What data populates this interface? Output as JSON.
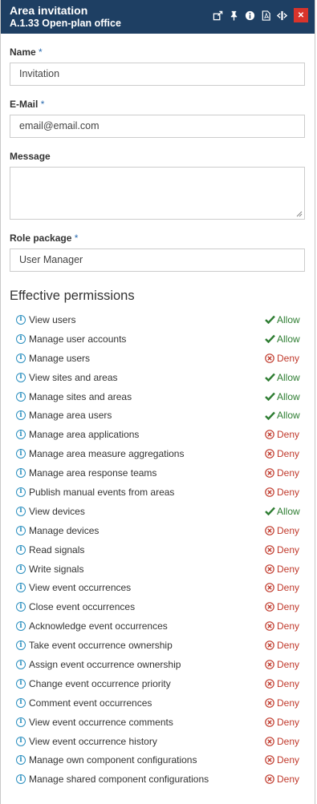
{
  "header": {
    "title": "Area invitation",
    "subtitle": "A.1.33 Open-plan office",
    "close_label": "✕"
  },
  "form": {
    "name_label": "Name",
    "name_required": "*",
    "name_value": "Invitation",
    "email_label": "E-Mail",
    "email_required": "*",
    "email_value": "email@email.com",
    "message_label": "Message",
    "message_value": "",
    "role_label": "Role package",
    "role_required": "*",
    "role_value": "User Manager"
  },
  "permissions": {
    "title": "Effective permissions",
    "items": [
      {
        "label": "View users",
        "status": "Allow"
      },
      {
        "label": "Manage user accounts",
        "status": "Allow"
      },
      {
        "label": "Manage users",
        "status": "Deny"
      },
      {
        "label": "View sites and areas",
        "status": "Allow"
      },
      {
        "label": "Manage sites and areas",
        "status": "Allow"
      },
      {
        "label": "Manage area users",
        "status": "Allow"
      },
      {
        "label": "Manage area applications",
        "status": "Deny"
      },
      {
        "label": "Manage area measure aggregations",
        "status": "Deny"
      },
      {
        "label": "Manage area response teams",
        "status": "Deny"
      },
      {
        "label": "Publish manual events from areas",
        "status": "Deny"
      },
      {
        "label": "View devices",
        "status": "Allow"
      },
      {
        "label": "Manage devices",
        "status": "Deny"
      },
      {
        "label": "Read signals",
        "status": "Deny"
      },
      {
        "label": "Write signals",
        "status": "Deny"
      },
      {
        "label": "View event occurrences",
        "status": "Deny"
      },
      {
        "label": "Close event occurrences",
        "status": "Deny"
      },
      {
        "label": "Acknowledge event occurrences",
        "status": "Deny"
      },
      {
        "label": "Take event occurrence ownership",
        "status": "Deny"
      },
      {
        "label": "Assign event occurrence ownership",
        "status": "Deny"
      },
      {
        "label": "Change event occurrence priority",
        "status": "Deny"
      },
      {
        "label": "Comment event occurrences",
        "status": "Deny"
      },
      {
        "label": "View event occurrence comments",
        "status": "Deny"
      },
      {
        "label": "View event occurrence history",
        "status": "Deny"
      },
      {
        "label": "Manage own component configurations",
        "status": "Deny"
      },
      {
        "label": "Manage shared component configurations",
        "status": "Deny"
      }
    ]
  },
  "colors": {
    "header_bg": "#1e3f63",
    "allow": "#2e7d32",
    "deny": "#c0392b",
    "info": "#2b8fbf",
    "close_bg": "#d9342b"
  },
  "icons": {
    "header": [
      "popout-icon",
      "pin-icon",
      "info-icon",
      "pdf-icon",
      "resize-icon",
      "close-icon"
    ],
    "allow": "check-icon",
    "deny": "x-circle-icon",
    "row": "info-circle-icon"
  }
}
